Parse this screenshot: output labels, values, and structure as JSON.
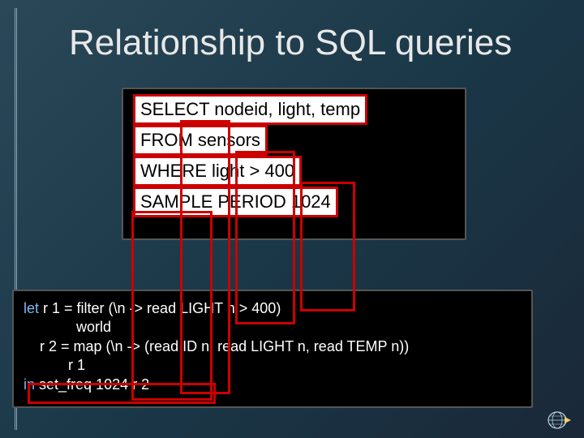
{
  "title": "Relationship to SQL queries",
  "sql": {
    "line1": "SELECT nodeid, light, temp",
    "line2": "FROM sensors",
    "line3": "WHERE light > 400",
    "line4": "SAMPLE PERIOD 1024"
  },
  "func": {
    "let": "let",
    "r1a": " r 1 = filter (\\n -> read LIGHT n > 400)",
    "r1b": "             world",
    "r2a": "    r 2 = map (\\n -> (read ID n, read LIGHT n, read TEMP n))",
    "r2b": "           r 1",
    "in": "in",
    "inrest": " set_freq 1024 r 2"
  }
}
